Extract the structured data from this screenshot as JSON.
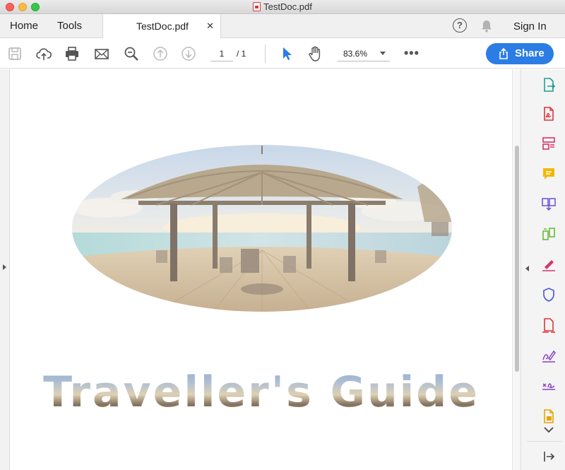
{
  "window": {
    "title": "TestDoc.pdf"
  },
  "tabs": {
    "home": "Home",
    "tools": "Tools",
    "document": "TestDoc.pdf"
  },
  "header": {
    "help": "?",
    "sign_in": "Sign In"
  },
  "toolbar": {
    "page_current": "1",
    "page_total": "/ 1",
    "zoom": "83.6%",
    "more": "•••",
    "share": "Share"
  },
  "document": {
    "heading": "Traveller's Guide"
  },
  "right_panel": {
    "tools": [
      "export-pdf-icon",
      "create-pdf-icon",
      "edit-pdf-icon",
      "comment-icon",
      "combine-files-icon",
      "organize-pages-icon",
      "fill-sign-icon",
      "protect-icon",
      "prepare-form-icon",
      "send-for-signature-icon",
      "certificates-icon",
      "scan-icon"
    ]
  },
  "colors": {
    "accent": "#2b7ce5",
    "select_tool": "#2b7ce5"
  }
}
